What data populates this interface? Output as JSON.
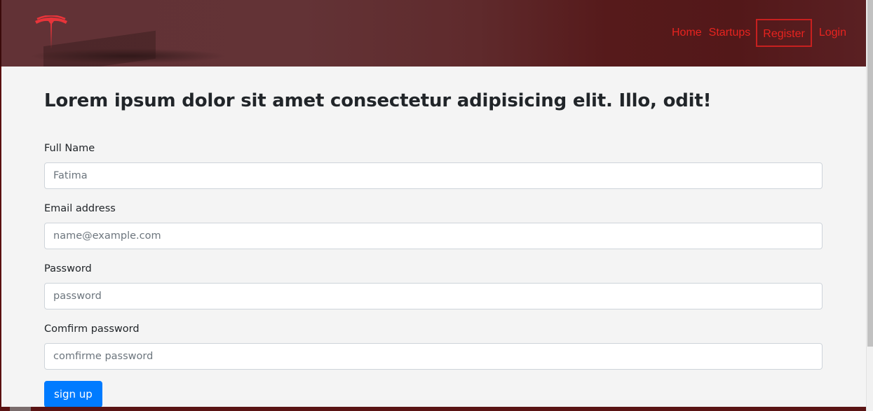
{
  "header": {
    "logo_icon": "tesla-t-logo-icon",
    "nav": [
      {
        "label": "Home"
      },
      {
        "label": "Startups"
      },
      {
        "label": "Register"
      },
      {
        "label": "Login"
      }
    ],
    "active_nav": "Register",
    "nav_color": "#e8231f"
  },
  "main": {
    "heading": "Lorem ipsum dolor sit amet consectetur adipisicing elit. Illo, odit!",
    "fields": [
      {
        "label": "Full Name",
        "value": "",
        "placeholder": "Fatima"
      },
      {
        "label": "Email address",
        "value": "",
        "placeholder": "name@example.com"
      },
      {
        "label": "Password",
        "value": "",
        "placeholder": "password"
      },
      {
        "label": "Comfirm password",
        "value": "",
        "placeholder": "comfirme password"
      }
    ],
    "submit_label": "sign up",
    "submit_color": "#007bff"
  }
}
